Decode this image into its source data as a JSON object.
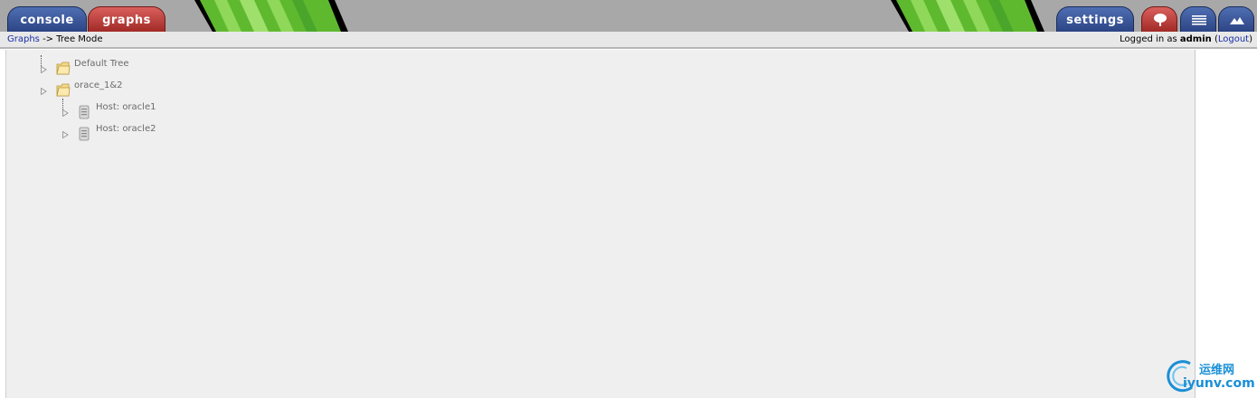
{
  "tabs": {
    "console": "console",
    "graphs": "graphs",
    "settings": "settings"
  },
  "icon_tabs": [
    "tree-view-icon",
    "list-view-icon",
    "preview-view-icon"
  ],
  "breadcrumb": {
    "link": "Graphs",
    "separator": "->",
    "current": "Tree Mode"
  },
  "login": {
    "prefix": "Logged in as",
    "user": "admin",
    "open_paren": "(",
    "logout": "Logout",
    "close_paren": ")"
  },
  "tree": [
    {
      "label": "Default Tree",
      "type": "tree",
      "level": 0
    },
    {
      "label": "orace_1&2",
      "type": "tree",
      "level": 0
    },
    {
      "label": "Host: oracle1",
      "type": "host",
      "level": 1
    },
    {
      "label": "Host: oracle2",
      "type": "host",
      "level": 1
    }
  ],
  "watermark": {
    "cn": "运维网",
    "en": "iyunv.com"
  },
  "colors": {
    "tab_blue": "#2c4484",
    "tab_red": "#a12a27",
    "link": "#1a2ea6",
    "tree_background": "#efefef",
    "header_gray": "#a8a8a8"
  }
}
